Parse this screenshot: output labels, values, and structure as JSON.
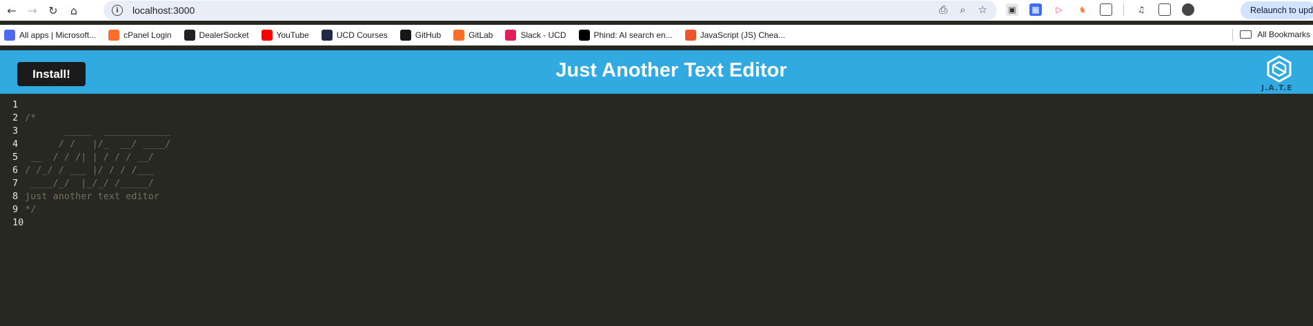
{
  "browser": {
    "url": "localhost:3000",
    "relaunch_label": "Relaunch to update",
    "bookmarks": [
      {
        "label": "All apps | Microsoft...",
        "icon": "microsoft-apps-icon",
        "color": "#4f6bed"
      },
      {
        "label": "cPanel Login",
        "icon": "cpanel-icon",
        "color": "#ff6c2c"
      },
      {
        "label": "DealerSocket",
        "icon": "dealersocket-icon",
        "color": "#222222"
      },
      {
        "label": "YouTube",
        "icon": "youtube-icon",
        "color": "#ff0000"
      },
      {
        "label": "UCD Courses",
        "icon": "ucd-courses-icon",
        "color": "#1f2a44"
      },
      {
        "label": "GitHub",
        "icon": "github-icon",
        "color": "#161616"
      },
      {
        "label": "GitLab",
        "icon": "gitlab-icon",
        "color": "#fc6d26"
      },
      {
        "label": "Slack - UCD",
        "icon": "slack-icon",
        "color": "#e01e5a"
      },
      {
        "label": "Phind: AI search en...",
        "icon": "phind-icon",
        "color": "#000000"
      },
      {
        "label": "JavaScript (JS) Chea...",
        "icon": "javascript-cheatsheet-icon",
        "color": "#e8572b"
      }
    ],
    "all_bookmarks_label": "All Bookmarks"
  },
  "app": {
    "install_label": "Install!",
    "title": "Just Another Text Editor",
    "logo_text": "J.A.T.E",
    "header_color": "#31a9e1"
  },
  "editor": {
    "lines": [
      {
        "num": "1",
        "text": ""
      },
      {
        "num": "2",
        "text": "/*"
      },
      {
        "num": "3",
        "text": "       _____  ____________"
      },
      {
        "num": "4",
        "text": "      / /   |/_  __/ ____/"
      },
      {
        "num": "5",
        "text": " __  / / /| | / / / __/"
      },
      {
        "num": "6",
        "text": "/ /_/ / ___ |/ / / /___"
      },
      {
        "num": "7",
        "text": " ____/_/  |_/_/ /_____/"
      },
      {
        "num": "8",
        "text": "just another text editor"
      },
      {
        "num": "9",
        "text": "*/"
      },
      {
        "num": "10",
        "text": ""
      }
    ]
  }
}
